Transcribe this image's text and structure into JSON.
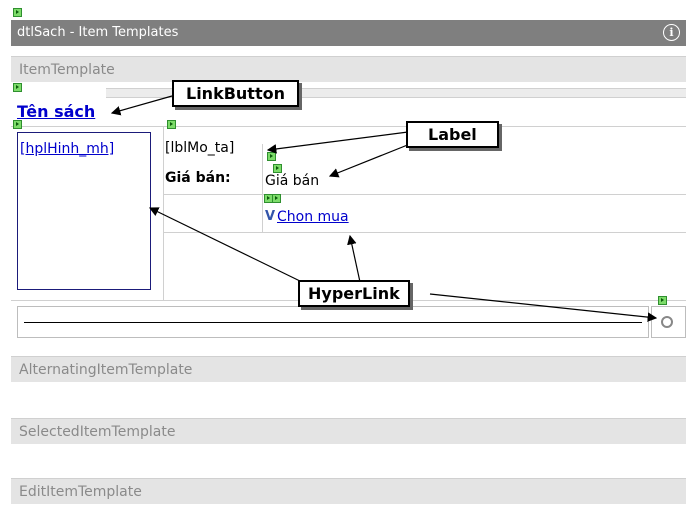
{
  "titlebar": {
    "title": "dtlSach - Item Templates",
    "info_glyph": "i"
  },
  "item_template": {
    "header": "ItemTemplate",
    "ten_sach_link": "Tên sách",
    "hinh_link": "[hplHinh_mh]",
    "mo_ta_label": "[lblMo_ta]",
    "gia_ban_caption": "Giá bán:",
    "gia_ban_value": "Giá bán",
    "chon_mua_link": "Chon mua"
  },
  "callouts": {
    "linkbutton": "LinkButton",
    "label": "Label",
    "hyperlink": "HyperLink"
  },
  "sections": {
    "alternating": "AlternatingItemTemplate",
    "selected": "SelectedItemTemplate",
    "edit": "EditItemTemplate"
  },
  "icons": [
    "smart-tag-icon",
    "info-icon",
    "cart-icon",
    "circle-button-icon"
  ],
  "colors": {
    "titlebar": "#7f7f7f",
    "section_header": "#e4e4e4",
    "link": "#0000cc",
    "frame_border": "#1b1b7a"
  }
}
